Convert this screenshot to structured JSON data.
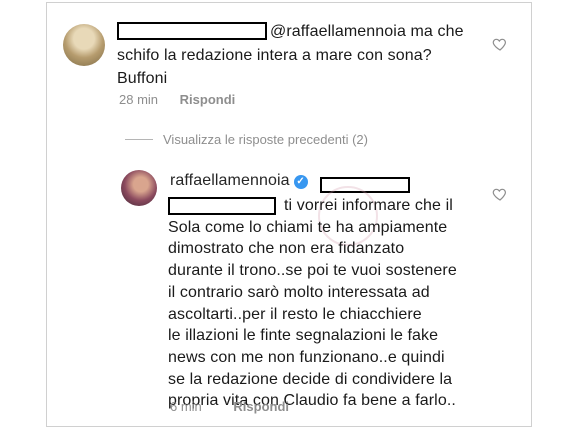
{
  "comment1": {
    "mention": "@raffaellamennoia",
    "line1_rest": " ma che",
    "line2": "schifo la redazione intera a mare con sona?",
    "line3": "Buffoni",
    "time": "28 min",
    "reply_label": "Rispondi"
  },
  "thread": {
    "view_replies_label": "Visualizza le risposte precedenti (2)"
  },
  "comment2": {
    "username": "raffaellamennoia",
    "lines": [
      "ti vorrei informare che il",
      "Sola come lo chiami te ha ampiamente",
      "dimostrato che non era fidanzato",
      "durante il trono..se poi te vuoi sostenere",
      "il contrario sarò molto interessata ad",
      "ascoltarti..per il resto le chiacchiere",
      "le illazioni le finte segnalazioni le fake",
      "news con me non funzionano..e quindi",
      "se la redazione decide di condividere la",
      "propria vita con Claudio fa bene a farlo.."
    ],
    "time": "6 min",
    "reply_label": "Rispondi"
  },
  "icons": {
    "like": "heart-outline-icon",
    "verified": "verified-badge-icon"
  },
  "colors": {
    "text": "#1a1a1a",
    "meta": "#8e8e8e",
    "verified": "#3897f0"
  }
}
